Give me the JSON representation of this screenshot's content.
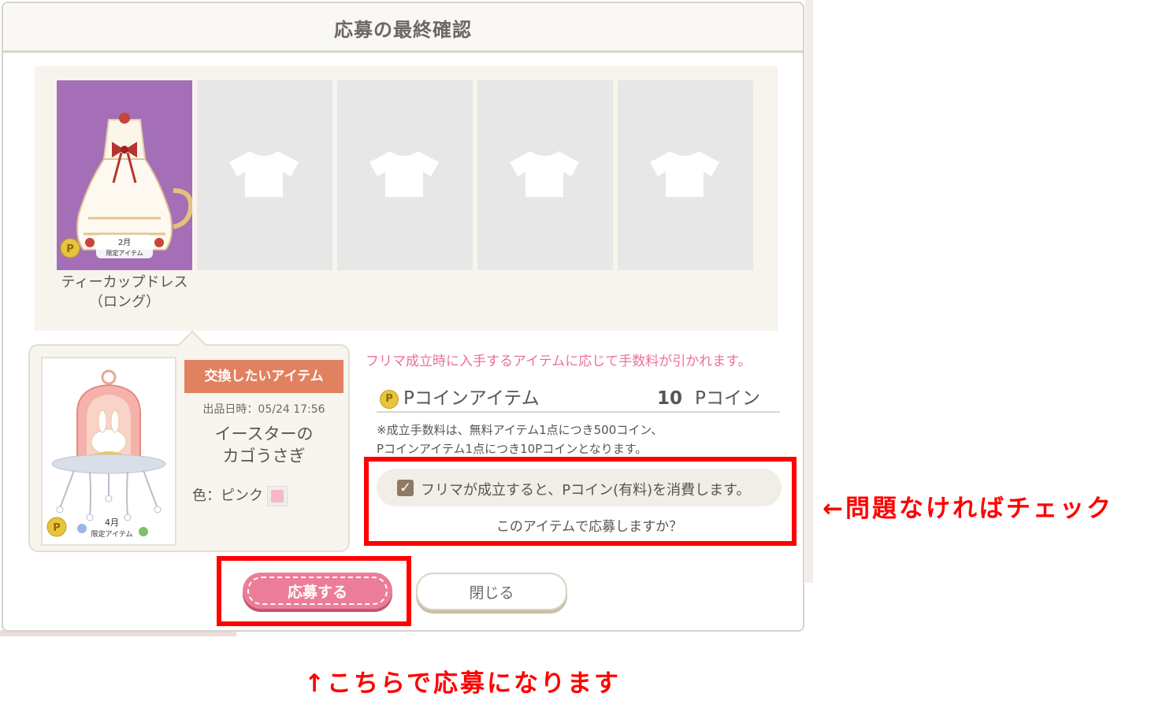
{
  "dialog": {
    "title": "応募の最終確認",
    "item": {
      "name_line1": "ティーカップドレス",
      "name_line2": "（ロング）",
      "badge_month": "2月",
      "badge_limited": "限定アイテム"
    },
    "empty_slots": 4,
    "exchange": {
      "tag": "交換したいアイテム",
      "listed": "出品日時：05/24 17:56",
      "name_line1": "イースターの",
      "name_line2": "カゴうさぎ",
      "color_label": "色：ピンク",
      "badge_month": "4月",
      "badge_limited": "限定アイテム"
    },
    "fee_note": "フリマ成立時に入手するアイテムに応じて手数料が引かれます。",
    "coin_symbol": "P",
    "p_item_label": "Pコインアイテム",
    "p_amount": "10",
    "p_unit": "Pコイン",
    "fee_detail_line1": "※成立手数料は、無料アイテム1点につき500コイン、",
    "fee_detail_line2": "Pコインアイテム1点につき10Pコインとなります。",
    "confirm_text": "フリマが成立すると、Pコイン(有料)を消費します。",
    "confirm_checked": true,
    "question": "このアイテムで応募しますか？",
    "apply_button": "応募する",
    "close_button": "閉じる"
  },
  "annotations": {
    "check_note": "←問題なければチェック",
    "apply_note": "↑こちらで応募になります"
  },
  "colors": {
    "accent_pink": "#ec7d98",
    "tag_orange": "#e2815f",
    "annotation_red": "#ff0000",
    "purple_slot": "#a46fb7"
  }
}
